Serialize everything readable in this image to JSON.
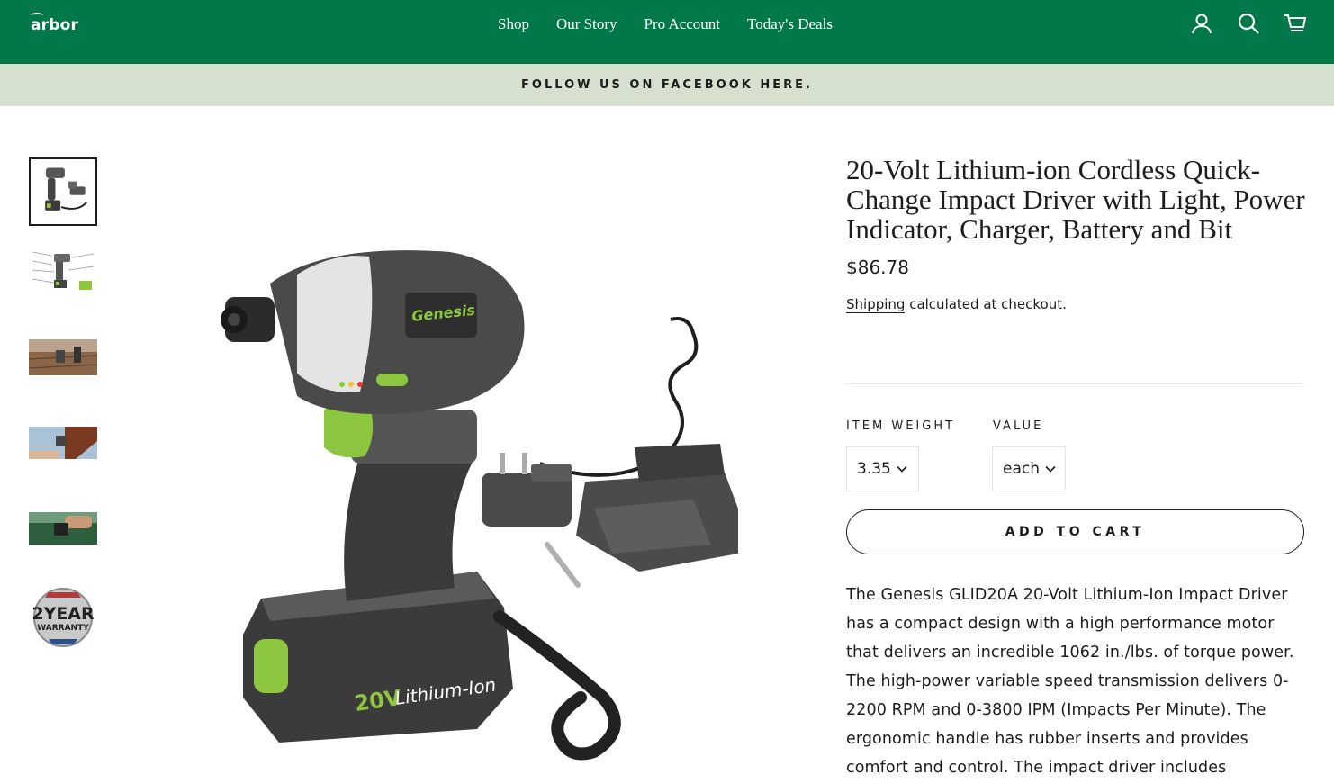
{
  "header": {
    "logo": "arbor",
    "nav": [
      "Shop",
      "Our Story",
      "Pro Account",
      "Today's Deals"
    ],
    "icons": [
      "account-icon",
      "search-icon",
      "cart-icon"
    ]
  },
  "announcement": "FOLLOW US ON FACEBOOK HERE.",
  "gallery": {
    "thumbnails": [
      "impact-driver-kit",
      "feature-diagram",
      "deck-use-photo",
      "roof-use-photo",
      "car-use-photo",
      "2-year-warranty-badge"
    ],
    "warranty_badge_line1": "2YEAR",
    "warranty_badge_line2": "WARRANTY",
    "brand_label": "Genesis",
    "battery_label": "20V Lithium-Ion"
  },
  "product": {
    "title": "20-Volt Lithium-ion Cordless Quick-Change Impact Driver with Light, Power Indicator, Charger, Battery and Bit",
    "price": "$86.78",
    "shipping_link": "Shipping",
    "shipping_rest": " calculated at checkout.",
    "options": [
      {
        "label": "ITEM WEIGHT",
        "value": "3.35"
      },
      {
        "label": "VALUE",
        "value": "each"
      }
    ],
    "add_to_cart": "ADD TO CART",
    "description": "The Genesis GLID20A 20-Volt Lithium-Ion Impact Driver has a compact design with a high performance motor that delivers an incredible 1062 in./lbs. of torque power. The high-power variable speed transmission delivers 0-2200 RPM and 0-3800 IPM (Impacts Per Minute). The ergonomic handle has rubber inserts and provides comfort and control. The impact driver includes"
  },
  "colors": {
    "header_bg": "#017848",
    "announce_bg": "#d5e0ce",
    "accent_green": "#8dc63f"
  }
}
